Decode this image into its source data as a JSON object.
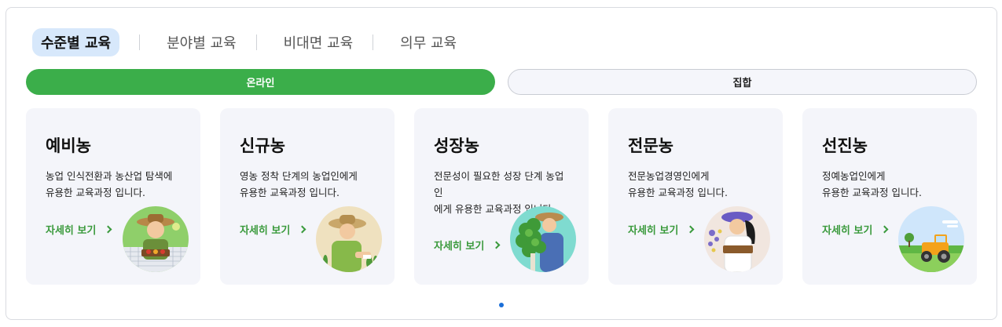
{
  "tabs": [
    {
      "label": "수준별 교육",
      "active": true
    },
    {
      "label": "분야별 교육",
      "active": false
    },
    {
      "label": "비대면 교육",
      "active": false
    },
    {
      "label": "의무 교육",
      "active": false
    }
  ],
  "toggle": {
    "online": "온라인",
    "offline": "집합"
  },
  "cards": [
    {
      "title": "예비농",
      "desc1": "농업 인식전환과 농산업 탐색에",
      "desc2": "유용한 교육과정 입니다.",
      "desc3": "",
      "link": "자세히 보기",
      "icon": "farmer-with-basket-icon"
    },
    {
      "title": "신규농",
      "desc1": "영농 정착 단계의 농업인에게",
      "desc2": "유용한 교육과정 입니다.",
      "desc3": "",
      "link": "자세히 보기",
      "icon": "farmer-planting-icon"
    },
    {
      "title": "성장농",
      "desc1": "전문성이 필요한 성장 단계 농업",
      "desc2": "인",
      "desc3": "에게 유용한 교육과정 입니다.",
      "link": "자세히 보기",
      "icon": "farmer-with-vegetables-icon"
    },
    {
      "title": "전문농",
      "desc1": "전문농업경영인에게",
      "desc2": "유용한 교육과정 입니다.",
      "desc3": "",
      "link": "자세히 보기",
      "icon": "farmer-with-flowers-icon"
    },
    {
      "title": "선진농",
      "desc1": "정예농업인에게",
      "desc2": "유용한 교육과정 입니다.",
      "desc3": "",
      "link": "자세히 보기",
      "icon": "tractor-field-icon"
    }
  ],
  "colors": {
    "accent_green": "#3bae4a",
    "active_tab_bg": "#d7e8fb",
    "card_bg": "#f4f5fa",
    "dot": "#1b6fd8"
  }
}
